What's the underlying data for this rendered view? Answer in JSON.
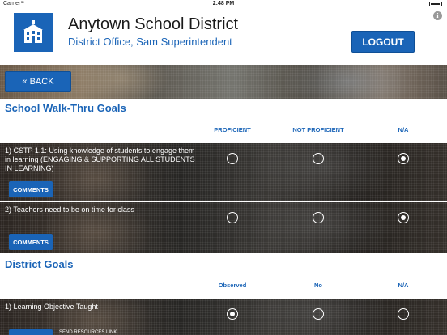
{
  "status_bar": {
    "carrier": "Carrier",
    "wifi_icon": "wifi-icon",
    "time": "2:48 PM",
    "battery_icon": "battery-icon"
  },
  "header": {
    "logo_icon": "school-building-icon",
    "title": "Anytown School District",
    "subtitle": "District Office, Sam Superintendent",
    "logout_label": "LOGOUT",
    "info_icon": "i"
  },
  "nav": {
    "back_label": "« BACK"
  },
  "walk_thru": {
    "title": "School Walk-Thru Goals",
    "columns": [
      "PROFICIENT",
      "NOT PROFICIENT",
      "N/A"
    ],
    "rows": [
      {
        "text": "1)  CSTP 1.1: Using knowledge of students to engage them in learning (ENGAGING & SUPPORTING ALL STUDENTS IN LEARNING)",
        "selected": "N/A",
        "comments_label": "COMMENTS"
      },
      {
        "text": "2)  Teachers need to be on time for class",
        "selected": "N/A",
        "comments_label": "COMMENTS"
      }
    ]
  },
  "district": {
    "title": "District  Goals",
    "columns": [
      "Observed",
      "No",
      "N/A"
    ],
    "rows": [
      {
        "text": "1)  Learning Objective Taught",
        "selected": "Observed",
        "send_link_label": "SEND RESOURCES LINK"
      }
    ]
  },
  "colors": {
    "brand_blue": "#1a64b7",
    "white": "#ffffff"
  }
}
